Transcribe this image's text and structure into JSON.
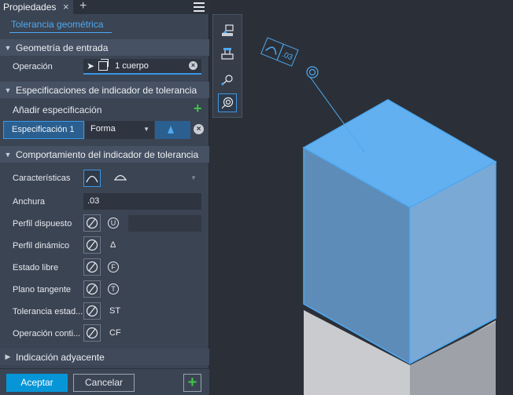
{
  "panel": {
    "tab_title": "Propiedades",
    "tab_close": "×",
    "tab_add": "+",
    "subtitle": "Tolerancia geométrica",
    "sections": {
      "input_geometry": "Geometría de entrada",
      "indicator_specs": "Especificaciones de indicador de tolerancia",
      "indicator_behavior": "Comportamiento del indicador de tolerancia",
      "adjacent": "Indicación adyacente"
    },
    "operation_label": "Operación",
    "operation_value": "1 cuerpo",
    "add_spec_label": "Añadir especificación",
    "spec_label": "Especificación 1",
    "spec_type": "Forma",
    "rows": {
      "characteristics": "Características",
      "width": "Anchura",
      "width_value": ".03",
      "profile_disposed": "Perfil dispuesto",
      "profile_dynamic": "Perfil dinámico",
      "free_state": "Estado libre",
      "tangent_plane": "Plano tangente",
      "statistical_tolerance": "Tolerancia estad...",
      "continuous_operation": "Operación conti..."
    },
    "modifiers": {
      "unequal": "U",
      "dynamic": "Δ",
      "free": "F",
      "tangent": "T",
      "statistical": "ST",
      "continuous": "CF"
    },
    "buttons": {
      "ok": "Aceptar",
      "cancel": "Cancelar",
      "add": "+"
    }
  },
  "toolbar": {
    "icons": [
      "datum-identifier-icon",
      "datum-target-icon",
      "surface-texture-icon",
      "geometric-tolerance-icon"
    ]
  },
  "viewport": {
    "annotation_value": ".03"
  },
  "colors": {
    "accent": "#3b97e3",
    "ok_button": "#0696d7",
    "add_green": "#3fc24a",
    "panel_bg": "#3b4453",
    "viewport_bg": "#2b3038",
    "selected_face": "#62b0f0"
  }
}
